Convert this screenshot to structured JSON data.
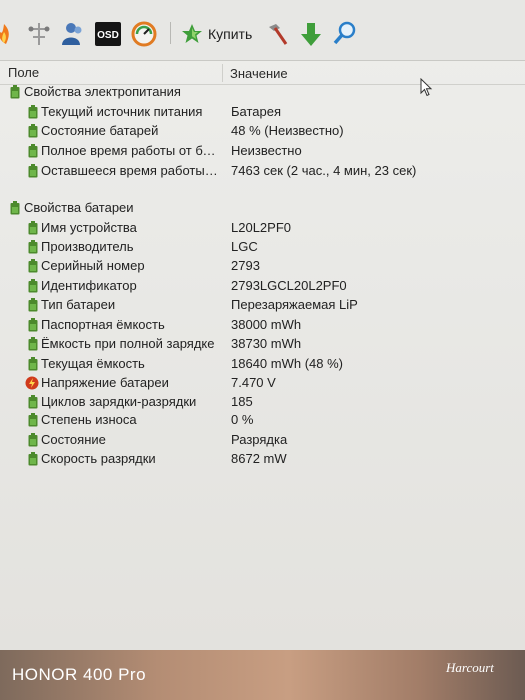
{
  "toolbar": {
    "osd_label": "OSD",
    "buy_label": "Купить",
    "icons": [
      "flame-icon",
      "network-icon",
      "users-icon",
      "osd-icon",
      "gauge-icon",
      "buy-star-icon",
      "tools-icon",
      "download-arrow-icon",
      "search-icon"
    ]
  },
  "table": {
    "col_field": "Поле",
    "col_value": "Значение"
  },
  "groups": [
    {
      "label": "Свойства электропитания",
      "items": [
        {
          "label": "Текущий источник питания",
          "value": "Батарея"
        },
        {
          "label": "Состояние батарей",
          "value": "48 % (Неизвестно)"
        },
        {
          "label": "Полное время работы от батареи",
          "value": "Неизвестно"
        },
        {
          "label": "Оставшееся время работы от батареи",
          "value": "7463 сек (2 час., 4 мин, 23 сек)"
        }
      ]
    },
    {
      "label": "Свойства батареи",
      "items": [
        {
          "label": "Имя устройства",
          "value": "L20L2PF0"
        },
        {
          "label": "Производитель",
          "value": "LGC"
        },
        {
          "label": "Серийный номер",
          "value": "2793"
        },
        {
          "label": "Идентификатор",
          "value": "2793LGCL20L2PF0"
        },
        {
          "label": "Тип батареи",
          "value": "Перезаряжаемая LiP"
        },
        {
          "label": "Паспортная ёмкость",
          "value": "38000 mWh"
        },
        {
          "label": "Ёмкость при полной зарядке",
          "value": "38730 mWh"
        },
        {
          "label": "Текущая ёмкость",
          "value": "18640 mWh  (48 %)"
        },
        {
          "label": "Напряжение батареи",
          "value": "7.470 V"
        },
        {
          "label": "Циклов зарядки-разрядки",
          "value": "185"
        },
        {
          "label": "Степень износа",
          "value": "0 %"
        },
        {
          "label": "Состояние",
          "value": "Разрядка"
        },
        {
          "label": "Скорость разрядки",
          "value": "8672 mW"
        }
      ]
    }
  ],
  "colors": {
    "battery_green": "#4c8a2c",
    "voltage_red": "#d03a1c"
  },
  "photo_watermark": "HONOR 400 Pro",
  "photo_logo": "Harcourt"
}
